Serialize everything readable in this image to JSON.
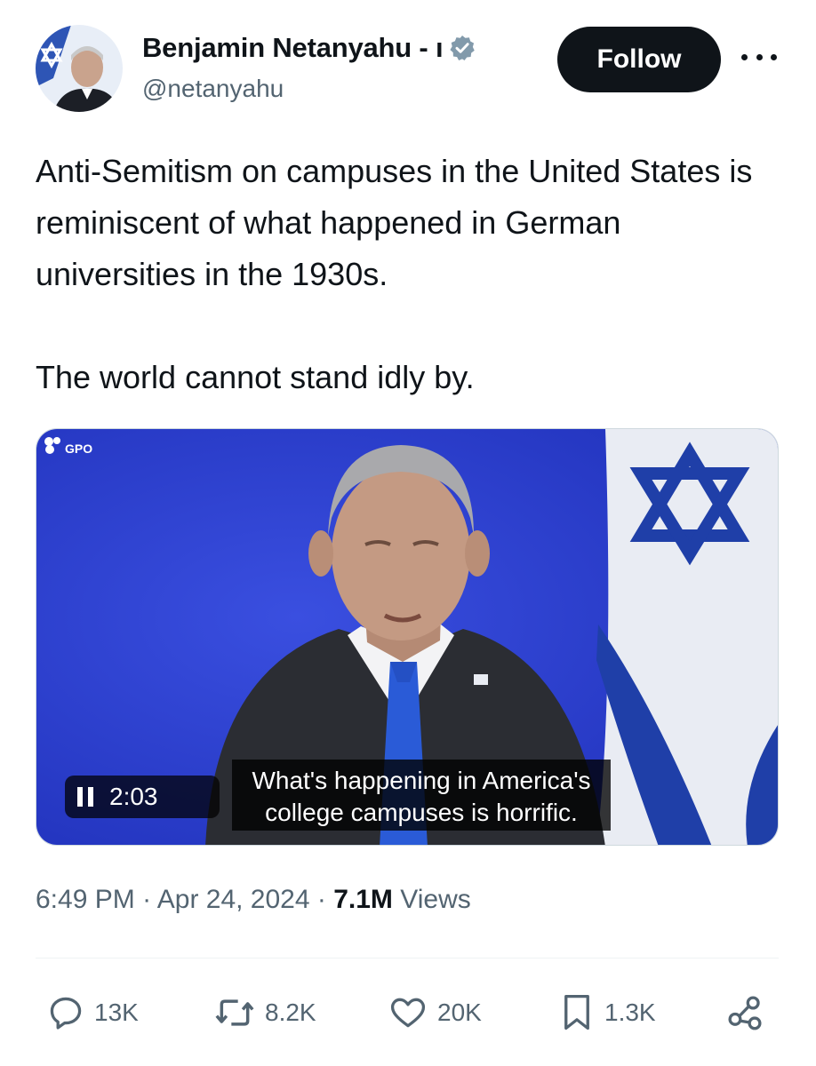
{
  "author": {
    "name": "Benjamin Netanyahu - ı",
    "handle": "@netanyahu",
    "verified": true
  },
  "follow_label": "Follow",
  "tweet": {
    "paragraph_1": "Anti-Semitism on campuses in the United States is reminiscent of what happened in German universities in the 1930s.",
    "paragraph_2": "The world cannot stand idly by."
  },
  "video": {
    "watermark": "GPO",
    "duration": "2:03",
    "subtitle_line_1": "What's happening in America's",
    "subtitle_line_2": "college campuses is horrific."
  },
  "timestamp": {
    "time": "6:49 PM",
    "date": "Apr 24, 2024",
    "views_count": "7.1M",
    "views_label": "Views"
  },
  "actions": {
    "replies": "13K",
    "reposts": "8.2K",
    "likes": "20K",
    "bookmarks": "1.3K"
  },
  "colors": {
    "text": "#0f1419",
    "secondary": "#536471",
    "verified_badge": "#829aab",
    "follow_bg": "#0f1419",
    "video_background_blue": "#2638c9",
    "flag_blue": "#1f3fa8"
  },
  "icons": [
    "verified-badge-icon",
    "more-icon",
    "pause-icon",
    "reply-icon",
    "repost-icon",
    "like-icon",
    "bookmark-icon",
    "share-icon"
  ]
}
